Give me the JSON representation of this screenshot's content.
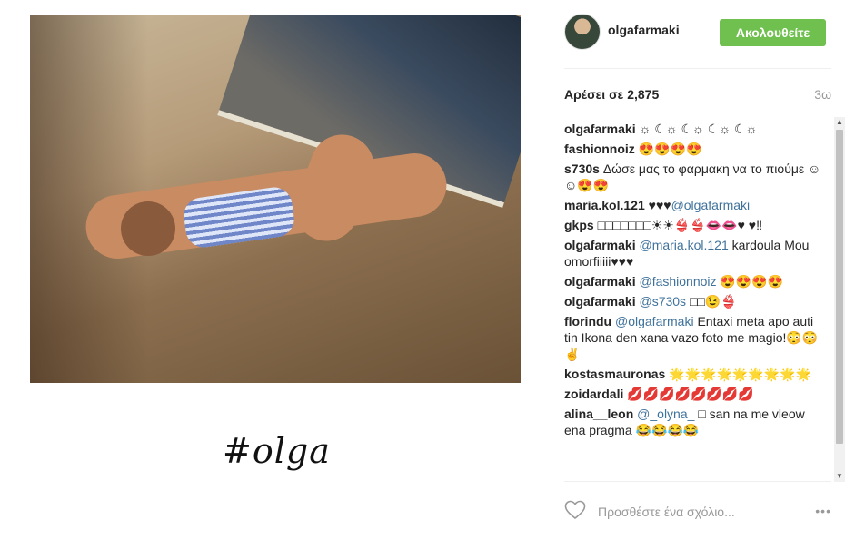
{
  "post": {
    "hashtag_caption": "#olga"
  },
  "header": {
    "username": "olgafarmaki",
    "follow_label": "Ακολουθείτε"
  },
  "stats": {
    "likes_label": "Αρέσει σε 2,875",
    "timestamp": "3ω"
  },
  "comments": [
    {
      "user": "olgafarmaki",
      "parts": [
        {
          "t": "☼ ☾☼ ☾☼ ☾☼ ☾☼"
        }
      ]
    },
    {
      "user": "fashionnoiz",
      "parts": [
        {
          "t": "😍😍😍😍"
        }
      ]
    },
    {
      "user": "s730s",
      "parts": [
        {
          "t": "Δώσε μας το φαρμακη να το πιούμε ☺☺😍😍"
        }
      ]
    },
    {
      "user": "maria.kol.121",
      "parts": [
        {
          "t": "♥♥♥"
        },
        {
          "m": "@olgafarmaki"
        }
      ]
    },
    {
      "user": "gkps",
      "parts": [
        {
          "t": "□□□□□□□☀☀👙👙👄👄♥ ♥‼"
        }
      ]
    },
    {
      "user": "olgafarmaki",
      "parts": [
        {
          "m": "@maria.kol.121"
        },
        {
          "t": " kardoula Mou omorfiiiii♥♥♥"
        }
      ]
    },
    {
      "user": "olgafarmaki",
      "parts": [
        {
          "m": "@fashionnoiz"
        },
        {
          "t": " 😍😍😍😍"
        }
      ]
    },
    {
      "user": "olgafarmaki",
      "parts": [
        {
          "m": "@s730s"
        },
        {
          "t": " □□😉👙"
        }
      ]
    },
    {
      "user": "florindu",
      "parts": [
        {
          "m": "@olgafarmaki"
        },
        {
          "t": " Entaxi meta apo auti tin Ikona den xana vazo foto me magio!😳😳✌"
        }
      ]
    },
    {
      "user": "kostasmauronas",
      "parts": [
        {
          "t": "🌟🌟🌟🌟🌟🌟🌟🌟🌟"
        }
      ]
    },
    {
      "user": "zoidardali",
      "parts": [
        {
          "t": "💋💋💋💋💋💋💋💋"
        }
      ]
    },
    {
      "user": "alina__leon",
      "parts": [
        {
          "m": "@_olyna_"
        },
        {
          "t": " □ san na me vleow ena pragma 😂😂😂😂"
        }
      ]
    }
  ],
  "footer": {
    "comment_placeholder": "Προσθέστε ένα σχόλιο...",
    "more_label": "•••"
  },
  "colors": {
    "follow_button": "#70c050",
    "mention": "#3f729b",
    "muted": "#999999"
  },
  "icons": [
    "heart-icon",
    "more-options-icon",
    "scroll-up-icon",
    "scroll-down-icon"
  ]
}
